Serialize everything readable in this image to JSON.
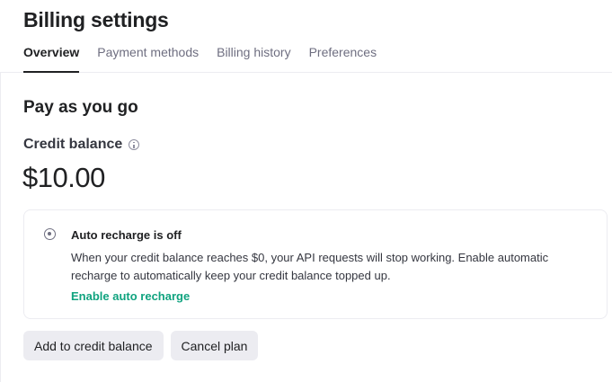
{
  "header": {
    "title": "Billing settings",
    "tabs": [
      {
        "label": "Overview",
        "active": true
      },
      {
        "label": "Payment methods",
        "active": false
      },
      {
        "label": "Billing history",
        "active": false
      },
      {
        "label": "Preferences",
        "active": false
      }
    ]
  },
  "main": {
    "section_title": "Pay as you go",
    "credit_label": "Credit balance",
    "credit_info_icon": "info-icon",
    "balance": "$10.00",
    "auto_recharge": {
      "status_icon": "radio-icon",
      "title": "Auto recharge is off",
      "description": "When your credit balance reaches $0, your API requests will stop working. Enable automatic recharge to automatically keep your credit balance topped up.",
      "link_label": "Enable auto recharge"
    },
    "actions": {
      "add_label": "Add to credit balance",
      "cancel_label": "Cancel plan"
    }
  },
  "colors": {
    "accent": "#10a37f",
    "text": "#202123",
    "button_bg": "#ececf1",
    "border": "#ececf1"
  }
}
